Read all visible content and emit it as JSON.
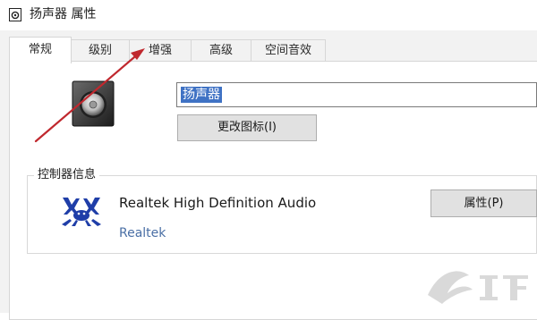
{
  "window": {
    "title": "扬声器 属性",
    "icon": "speaker-small-icon"
  },
  "tabs": [
    {
      "label": "常规",
      "active": true
    },
    {
      "label": "级别",
      "active": false
    },
    {
      "label": "增强",
      "active": false
    },
    {
      "label": "高级",
      "active": false
    },
    {
      "label": "空间音效",
      "active": false
    }
  ],
  "general": {
    "device_icon": "speaker-icon",
    "name_value": "扬声器",
    "change_icon_label": "更改图标(I)"
  },
  "controller": {
    "group_title": "控制器信息",
    "logo": "realtek-crab-icon",
    "device_name": "Realtek High Definition Audio",
    "vendor": "Realtek",
    "properties_label": "属性(P)"
  },
  "annotation": {
    "arrow_color": "#c0282e"
  },
  "colors": {
    "selection": "#3f72c4",
    "realtek_blue": "#1f3ea8",
    "vendor_text": "#4a6fa5"
  }
}
